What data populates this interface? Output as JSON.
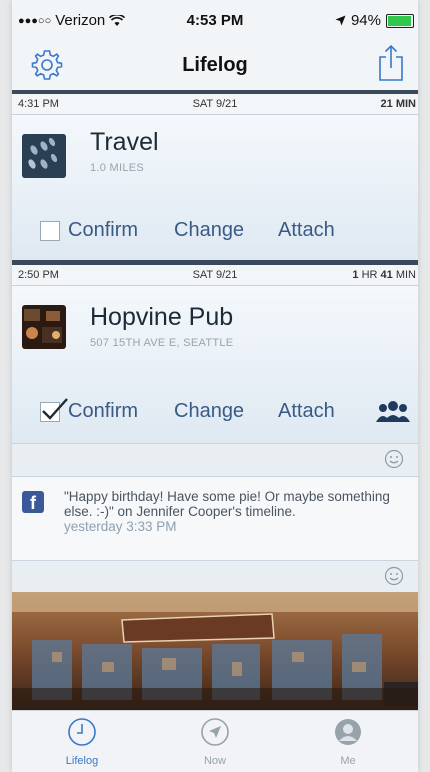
{
  "status_bar": {
    "carrier": "Verizon",
    "time": "4:53 PM",
    "battery": "94%",
    "battery_level": 0.94
  },
  "nav": {
    "title": "Lifelog"
  },
  "entries": [
    {
      "time": "4:31 PM",
      "date": "SAT 9/21",
      "duration_value": "21",
      "duration_unit": "MIN",
      "title": "Travel",
      "subtitle": "1.0 MILES",
      "icon": "footprints-icon",
      "actions": {
        "confirm": "Confirm",
        "change": "Change",
        "attach": "Attach"
      },
      "confirmed": false
    },
    {
      "time": "2:50 PM",
      "date": "SAT 9/21",
      "duration_prefix": "1",
      "duration_mid": " HR ",
      "duration_value": "41",
      "duration_unit": " MIN",
      "title": "Hopvine Pub",
      "subtitle": "507 15TH AVE E, SEATTLE",
      "icon": "pub-photo",
      "actions": {
        "confirm": "Confirm",
        "change": "Change",
        "attach": "Attach"
      },
      "confirmed": true
    }
  ],
  "facebook_post": {
    "text": "\"Happy birthday! Have some pie! Or maybe something else. :-)\" on Jennifer Cooper's timeline.",
    "time": "yesterday 3:33 PM"
  },
  "tabs": [
    {
      "label": "Lifelog",
      "icon": "clock-icon",
      "active": true
    },
    {
      "label": "Now",
      "icon": "location-arrow-icon",
      "active": false
    },
    {
      "label": "Me",
      "icon": "person-icon",
      "active": false
    }
  ],
  "colors": {
    "accent": "#3a78c9",
    "divider": "#3b4a5a",
    "link": "#3a5a86",
    "facebook": "#3b5998"
  }
}
